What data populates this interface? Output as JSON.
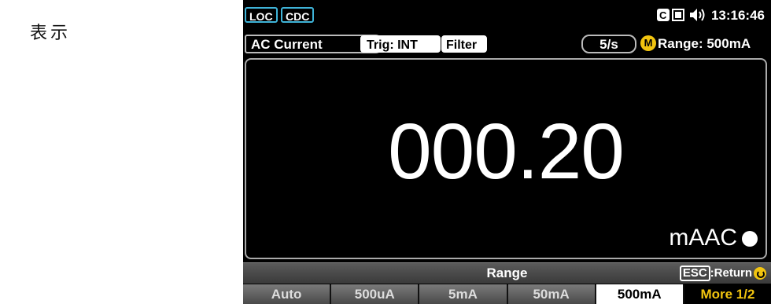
{
  "side_label": "表示",
  "status": {
    "loc": "LOC",
    "cdc": "CDC",
    "clock": "13:16:46",
    "icons": [
      "c-icon",
      "usb-icon",
      "speaker-icon"
    ]
  },
  "info": {
    "function": "AC Current",
    "trig": "Trig: INT",
    "filter": "Filter",
    "rate": "5/s",
    "range_mode": "M",
    "range": "Range: 500mA"
  },
  "display": {
    "reading": "000.20",
    "unit": "mAAC"
  },
  "menu": {
    "title": "Range",
    "esc": "ESC",
    "return": ":Return"
  },
  "softkeys": [
    "Auto",
    "500uA",
    "5mA",
    "50mA",
    "500mA",
    "More 1/2"
  ],
  "colors": {
    "accent_yellow": "#f1c40f",
    "tag_border": "#3fb4d8"
  }
}
